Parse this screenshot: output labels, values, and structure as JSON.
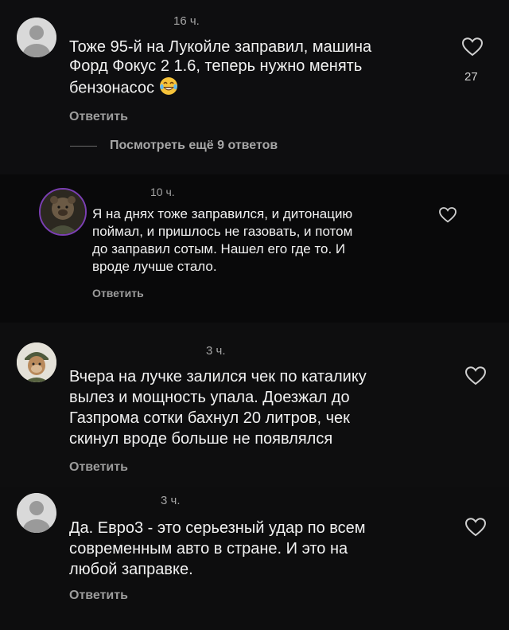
{
  "comments": [
    {
      "time": "16 ч.",
      "lines": [
        "Тоже 95-й на Лукойле заправил, машина",
        "Форд Фокус 2 1.6, теперь нужно менять",
        "бензонасос"
      ],
      "emoji": "laughing-tears-emoji",
      "reply_label": "Ответить",
      "likes": "27",
      "view_more": "Посмотреть ещё 9 ответов"
    },
    {
      "time": "10 ч.",
      "lines": [
        "Я на днях тоже заправился, и дитонацию",
        "поймал, и пришлось не газовать, и потом",
        "до заправил сотым. Нашел его где то. И",
        "вроде лучше стало."
      ],
      "reply_label": "Ответить"
    },
    {
      "time": "3 ч.",
      "lines": [
        "Вчера на лучке залился чек по каталику",
        "вылез и мощность упала. Доезжал до",
        "Газпрома сотки бахнул 20 литров, чек",
        "скинул вроде больше не появлялся"
      ],
      "reply_label": "Ответить"
    },
    {
      "time": "3 ч.",
      "lines": [
        "Да. Евро3 - это серьезный удар по всем",
        "современным авто в стране. И это на",
        "любой заправке."
      ],
      "reply_label": "Ответить"
    }
  ],
  "icons": {
    "heart": "heart-outline-icon",
    "avatar_default": "default-user-avatar-icon"
  },
  "colors": {
    "background": "#0b0b0c",
    "text": "#f1f1f1",
    "muted": "#a5a5a5",
    "heart": "#cfcfcf"
  }
}
